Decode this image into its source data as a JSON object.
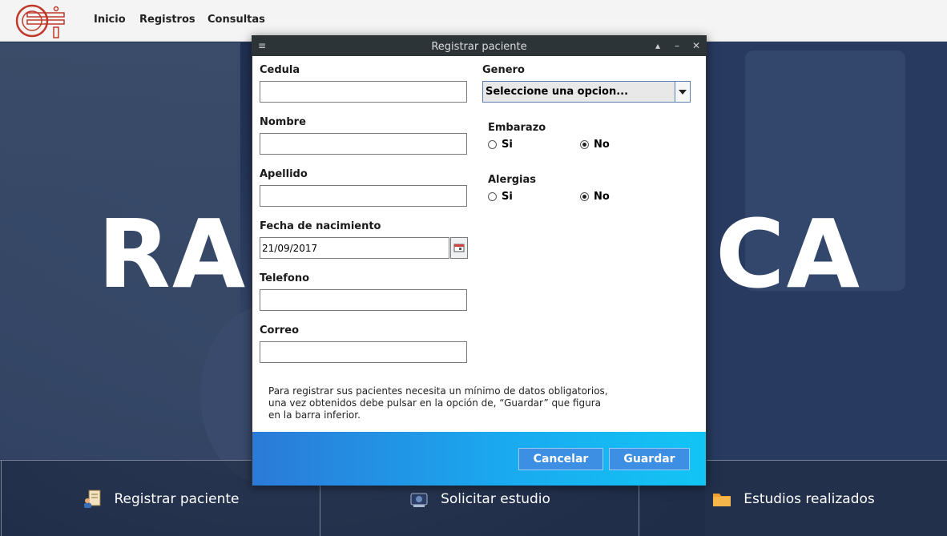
{
  "nav": {
    "items": [
      "Inicio",
      "Registros",
      "Consultas"
    ]
  },
  "background": {
    "left_text": "RA",
    "right_text": "CA"
  },
  "bottom_bar": {
    "items": [
      {
        "label": "Registrar paciente",
        "icon": "patient-record-icon"
      },
      {
        "label": "Solicitar estudio",
        "icon": "scanner-icon"
      },
      {
        "label": "Estudios realizados",
        "icon": "folder-icon"
      }
    ]
  },
  "dialog": {
    "title": "Registrar paciente",
    "fields": {
      "cedula": {
        "label": "Cedula",
        "value": ""
      },
      "nombre": {
        "label": "Nombre",
        "value": ""
      },
      "apellido": {
        "label": "Apellido",
        "value": ""
      },
      "fecha": {
        "label": "Fecha de nacimiento",
        "value": "21/09/2017"
      },
      "telefono": {
        "label": "Telefono",
        "value": ""
      },
      "correo": {
        "label": "Correo",
        "value": ""
      }
    },
    "genero": {
      "label": "Genero",
      "selected": "Seleccione una opcion..."
    },
    "embarazo": {
      "label": "Embarazo",
      "options": [
        "Si",
        "No"
      ],
      "selected": "No"
    },
    "alergias": {
      "label": "Alergias",
      "options": [
        "Si",
        "No"
      ],
      "selected": "No"
    },
    "info_lines": [
      "Para registrar sus pacientes necesita un mínimo de datos obligatorios,",
      "una vez obtenidos debe pulsar en la opción de, “Guardar” que figura",
      "en la barra inferior."
    ],
    "buttons": {
      "cancel": "Cancelar",
      "save": "Guardar"
    }
  },
  "colors": {
    "footer_start": "#2b7ad8",
    "footer_end": "#12c5f5",
    "button": "#3d8fe3",
    "logo": "#c0392b"
  }
}
